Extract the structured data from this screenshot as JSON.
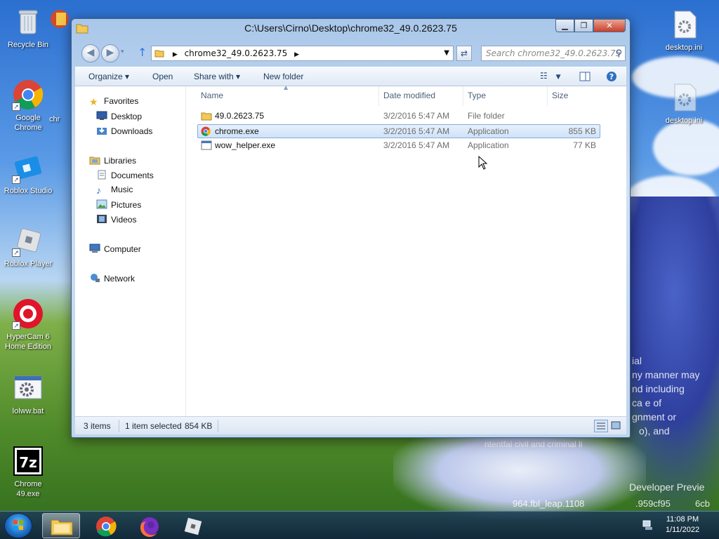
{
  "desktop": {
    "icons": [
      {
        "label": "Recycle Bin"
      },
      {
        "label": "Google\nChrome"
      },
      {
        "label": "chr"
      },
      {
        "label": "Roblox Studio"
      },
      {
        "label": "Roblox Player"
      },
      {
        "label": "HyperCam 6\nHome Edition"
      },
      {
        "label": "lolww.bat"
      },
      {
        "label": "Chrome\n49.exe"
      },
      {
        "label": "desktop.ini"
      },
      {
        "label": "desktop.ini"
      }
    ],
    "bg_texts": [
      "ial",
      "ny manner may",
      "nd including",
      "ca e of",
      "gnment or",
      "o), and",
      "ntentfal civil and criminal li",
      "Developer Previe",
      "964.fbl_leap.1108",
      ".959cf95",
      "6cb"
    ]
  },
  "window": {
    "title": "C:\\Users\\Cirno\\Desktop\\chrome32_49.0.2623.75",
    "controls": {
      "minimize": "▁",
      "maximize": "❐",
      "close": "✕"
    },
    "address": {
      "crumb": "chrome32_49.0.2623.75"
    },
    "search": {
      "placeholder": "Search chrome32_49.0.2623.75"
    },
    "toolbar": {
      "organize": "Organize ▾",
      "open": "Open",
      "share_with": "Share with ▾",
      "new_folder": "New folder"
    },
    "navpane": {
      "favorites": "Favorites",
      "desktop": "Desktop",
      "downloads": "Downloads",
      "libraries": "Libraries",
      "documents": "Documents",
      "music": "Music",
      "pictures": "Pictures",
      "videos": "Videos",
      "computer": "Computer",
      "network": "Network"
    },
    "columns": {
      "name": "Name",
      "date": "Date modified",
      "type": "Type",
      "size": "Size"
    },
    "files": [
      {
        "name": "49.0.2623.75",
        "date": "3/2/2016 5:47 AM",
        "type": "File folder",
        "size": ""
      },
      {
        "name": "chrome.exe",
        "date": "3/2/2016 5:47 AM",
        "type": "Application",
        "size": "855 KB"
      },
      {
        "name": "wow_helper.exe",
        "date": "3/2/2016 5:47 AM",
        "type": "Application",
        "size": "77 KB"
      }
    ],
    "status": {
      "items": "3 items",
      "selected": "1 item selected",
      "size": "854 KB"
    }
  },
  "taskbar": {
    "clock_time": "11:08 PM",
    "clock_date": "1/11/2022"
  }
}
